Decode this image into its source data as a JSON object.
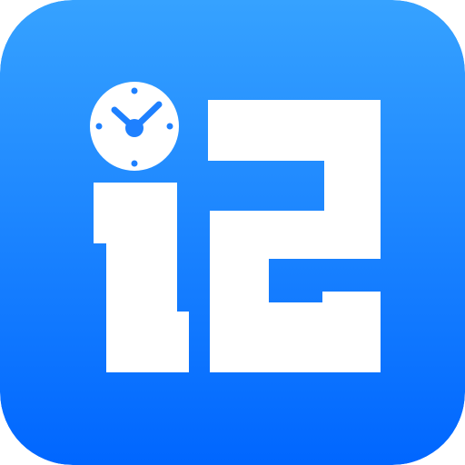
{
  "app_icon": {
    "name": "i2",
    "icon": "clock-icon",
    "colors": {
      "background_top": "#36A2FF",
      "background_bottom": "#0066FF",
      "glyph": "#FFFFFF",
      "clock_detail": "#1E80FF"
    }
  }
}
